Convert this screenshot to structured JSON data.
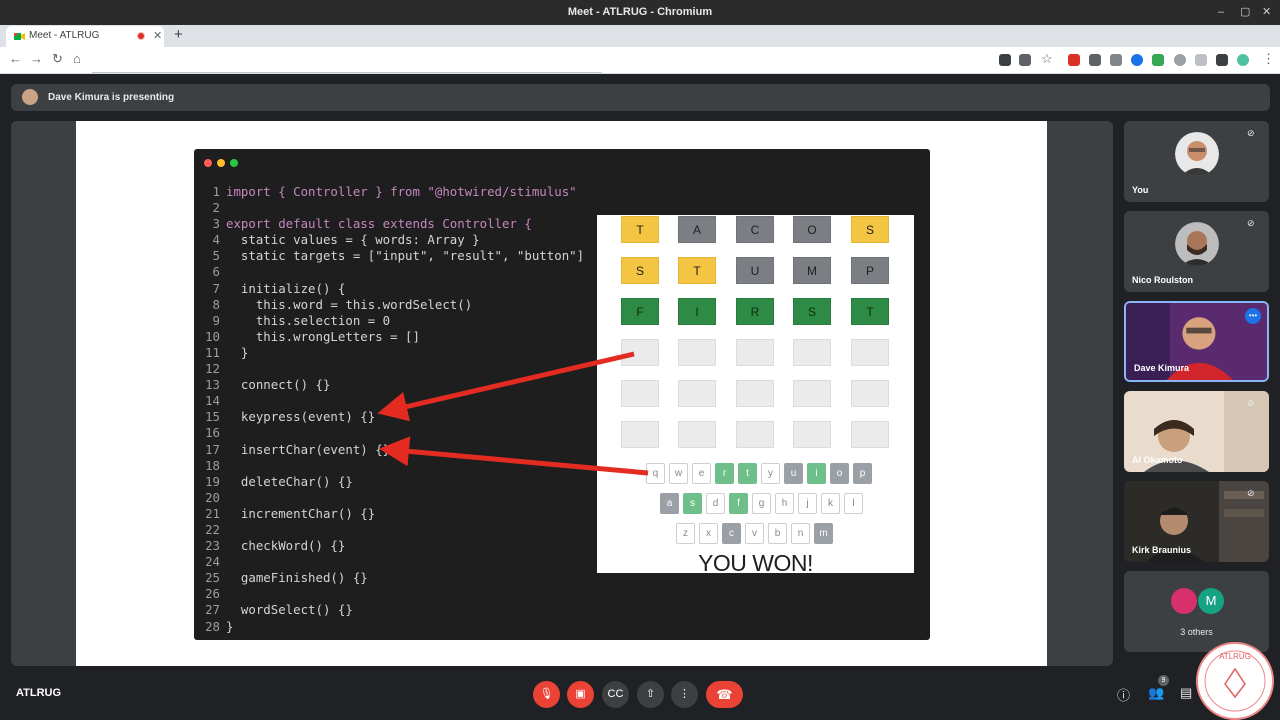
{
  "window": {
    "title": "Meet - ATLRUG - Chromium"
  },
  "tab": {
    "title": "Meet - ATLRUG"
  },
  "presenting": {
    "text": "Dave Kimura is presenting"
  },
  "code": {
    "lines": [
      "import { Controller } from \"@hotwired/stimulus\"",
      "",
      "export default class extends Controller {",
      "  static values = { words: Array }",
      "  static targets = [\"input\", \"result\", \"button\"]",
      "",
      "  initialize() {",
      "    this.word = this.wordSelect()",
      "    this.selection = 0",
      "    this.wrongLetters = []",
      "  }",
      "",
      "  connect() {}",
      "",
      "  keypress(event) {}",
      "",
      "  insertChar(event) {}",
      "",
      "  deleteChar() {}",
      "",
      "  incrementChar() {}",
      "",
      "  checkWord() {}",
      "",
      "  gameFinished() {}",
      "",
      "  wordSelect() {}",
      "}"
    ]
  },
  "game": {
    "rows": [
      [
        {
          "l": "T",
          "s": "y"
        },
        {
          "l": "A",
          "s": "d"
        },
        {
          "l": "C",
          "s": "d"
        },
        {
          "l": "O",
          "s": "d"
        },
        {
          "l": "S",
          "s": "y"
        }
      ],
      [
        {
          "l": "S",
          "s": "y"
        },
        {
          "l": "T",
          "s": "y"
        },
        {
          "l": "U",
          "s": "d"
        },
        {
          "l": "M",
          "s": "d"
        },
        {
          "l": "P",
          "s": "d"
        }
      ],
      [
        {
          "l": "F",
          "s": "g"
        },
        {
          "l": "I",
          "s": "g"
        },
        {
          "l": "R",
          "s": "g"
        },
        {
          "l": "S",
          "s": "g"
        },
        {
          "l": "T",
          "s": "g"
        }
      ],
      [
        {
          "l": "",
          "s": "e"
        },
        {
          "l": "",
          "s": "e"
        },
        {
          "l": "",
          "s": "e"
        },
        {
          "l": "",
          "s": "e"
        },
        {
          "l": "",
          "s": "e"
        }
      ],
      [
        {
          "l": "",
          "s": "e"
        },
        {
          "l": "",
          "s": "e"
        },
        {
          "l": "",
          "s": "e"
        },
        {
          "l": "",
          "s": "e"
        },
        {
          "l": "",
          "s": "e"
        }
      ],
      [
        {
          "l": "",
          "s": "e"
        },
        {
          "l": "",
          "s": "e"
        },
        {
          "l": "",
          "s": "e"
        },
        {
          "l": "",
          "s": "e"
        },
        {
          "l": "",
          "s": "e"
        }
      ]
    ],
    "keyboard": [
      [
        {
          "k": "q",
          "s": ""
        },
        {
          "k": "w",
          "s": ""
        },
        {
          "k": "e",
          "s": ""
        },
        {
          "k": "r",
          "s": "g"
        },
        {
          "k": "t",
          "s": "g"
        },
        {
          "k": "y",
          "s": ""
        },
        {
          "k": "u",
          "s": "d"
        },
        {
          "k": "i",
          "s": "g"
        },
        {
          "k": "o",
          "s": "d"
        },
        {
          "k": "p",
          "s": "d"
        }
      ],
      [
        {
          "k": "a",
          "s": "d"
        },
        {
          "k": "s",
          "s": "g"
        },
        {
          "k": "d",
          "s": ""
        },
        {
          "k": "f",
          "s": "g"
        },
        {
          "k": "g",
          "s": ""
        },
        {
          "k": "h",
          "s": ""
        },
        {
          "k": "j",
          "s": ""
        },
        {
          "k": "k",
          "s": ""
        },
        {
          "k": "l",
          "s": ""
        }
      ],
      [
        {
          "k": "z",
          "s": ""
        },
        {
          "k": "x",
          "s": ""
        },
        {
          "k": "c",
          "s": "d"
        },
        {
          "k": "v",
          "s": ""
        },
        {
          "k": "b",
          "s": ""
        },
        {
          "k": "n",
          "s": ""
        },
        {
          "k": "m",
          "s": "d"
        }
      ]
    ],
    "message": "YOU WON!"
  },
  "participants": {
    "you": "You",
    "nico": "Nico Roulston",
    "dave": "Dave Kimura",
    "al": "Al Okamoto",
    "kirk": "Kirk Braunius",
    "others": "3 others",
    "others_initial": "M"
  },
  "bottom": {
    "meeting_name": "ATLRUG",
    "people_count": "9"
  },
  "colors": {
    "accent_red": "#ea4335",
    "wordle_green": "#2e8b46",
    "wordle_yellow": "#f4c542",
    "meet_bg": "#202124",
    "active_border": "#8ab4f8"
  }
}
